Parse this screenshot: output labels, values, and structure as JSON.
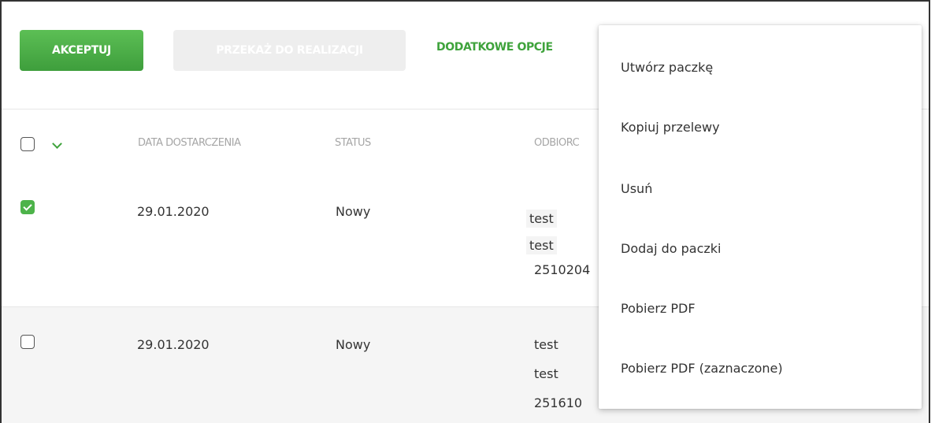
{
  "toolbar": {
    "accept_label": "AKCEPTUJ",
    "transfer_label": "PRZEKAŻ DO REALIZACJI",
    "more_options_label": "DODATKOWE OPCJE"
  },
  "table": {
    "columns": [
      "DATA DOSTARCZENIA",
      "STATUS",
      "ODBIORC"
    ],
    "rows": [
      {
        "checked": true,
        "date": "29.01.2020",
        "status": "Nowy",
        "recipient": [
          "test",
          "test",
          "2510204"
        ]
      },
      {
        "checked": false,
        "date": "29.01.2020",
        "status": "Nowy",
        "recipient": [
          "test",
          "test",
          "251610"
        ]
      }
    ]
  },
  "menu": {
    "items": [
      "Utwórz paczkę",
      "Kopiuj przelewy",
      "Usuń",
      "Dodaj do paczki",
      "Pobierz PDF",
      "Pobierz PDF (zaznaczone)"
    ]
  },
  "colors": {
    "accent": "#4db34a",
    "link": "#3fa33c"
  }
}
